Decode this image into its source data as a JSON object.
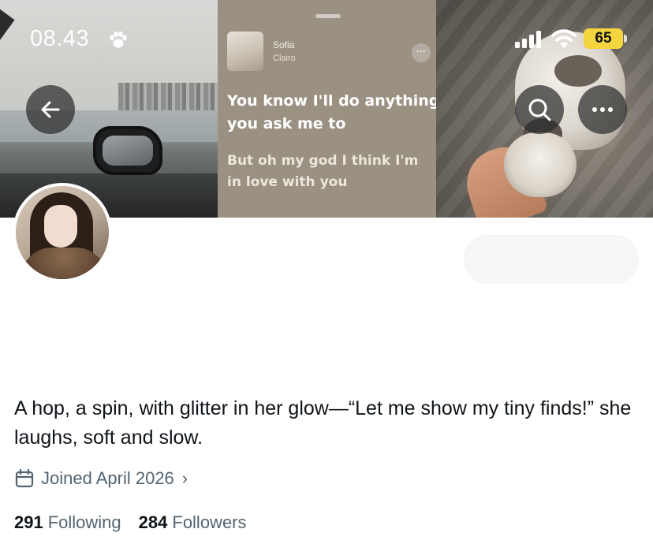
{
  "status_bar": {
    "time": "08.43",
    "battery": "65"
  },
  "banner": {
    "song_title": "Sofia",
    "song_artist": "Clairo",
    "lyric_line_1": "You know I'll do anything you ask me to",
    "lyric_line_2": "But oh my god I think I'm in love with you"
  },
  "profile": {
    "bio": "A hop, a spin, with glitter in her glow—“Let me show my tiny finds!” she laughs, soft and slow.",
    "joined": "Joined April 2026",
    "joined_chevron": "›",
    "following_count": "291",
    "following_label": "Following",
    "followers_count": "284",
    "followers_label": "Followers"
  },
  "icons": {
    "back": "back-arrow-icon",
    "search": "search-icon",
    "more": "more-icon",
    "calendar": "calendar-icon",
    "paw": "paw-icon"
  },
  "colors": {
    "battery": "#f4d43f",
    "secondary_text": "#536471",
    "primary_text": "#0f1419"
  }
}
